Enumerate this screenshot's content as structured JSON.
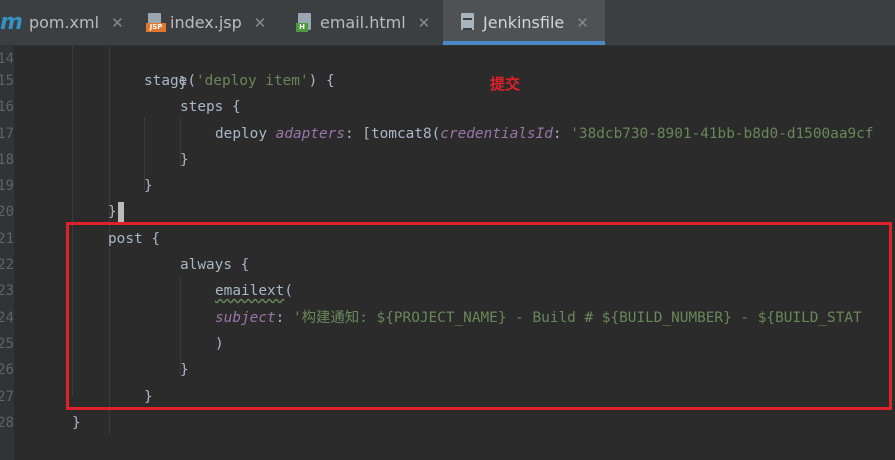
{
  "tabs": [
    {
      "label": "pom.xml",
      "icon": "maven-icon",
      "active": false
    },
    {
      "label": "index.jsp",
      "icon": "jsp-file-icon",
      "badge": "JSP",
      "active": false
    },
    {
      "label": "email.html",
      "icon": "html-file-icon",
      "badge": "H",
      "active": false
    },
    {
      "label": "Jenkinsfile",
      "icon": "jenkinsfile-icon",
      "active": true
    }
  ],
  "tab_close_glyph": "✕",
  "maven_glyph": "m",
  "gutter": {
    "line_numbers": [
      "14",
      "15",
      "16",
      "17",
      "18",
      "19",
      "20",
      "21",
      "22",
      "23",
      "24",
      "25",
      "26",
      "27",
      "28"
    ]
  },
  "code": {
    "l14": {
      "text": "}"
    },
    "l15": {
      "kw": "stage(",
      "str": "'deploy item'",
      "rest": ") {"
    },
    "l16": {
      "text": "steps {"
    },
    "l17": {
      "kw": "deploy ",
      "p1": "adapters",
      "t1": ": [tomcat8(",
      "p2": "credentialsId",
      "t2": ": ",
      "str": "'38dcb730-8901-41bb-b8d0-d1500aa9cf"
    },
    "l18": {
      "text": "}"
    },
    "l19": {
      "text": "}"
    },
    "l20": {
      "text": "}"
    },
    "l21": {
      "text": "post {"
    },
    "l22": {
      "text": "always {"
    },
    "l23": {
      "kw": "emailext",
      "rest": "("
    },
    "l24": {
      "p1": "subject",
      "t1": ": ",
      "str": "'构建通知: ${PROJECT_NAME} - Build # ${BUILD_NUMBER} - ${BUILD_STAT"
    },
    "l25": {
      "text": ")"
    },
    "l26": {
      "text": "}"
    },
    "l27": {
      "text": "}"
    },
    "l28": {
      "text": "}"
    }
  },
  "annotation": {
    "text": "提交",
    "color": "#e0202a"
  },
  "colors": {
    "background": "#2b2b2b",
    "code_default": "#a9b7c6",
    "string": "#6a8759",
    "param": "#9876aa",
    "active_tab_underline": "#4a88c7",
    "highlight_box": "#e0202a"
  }
}
